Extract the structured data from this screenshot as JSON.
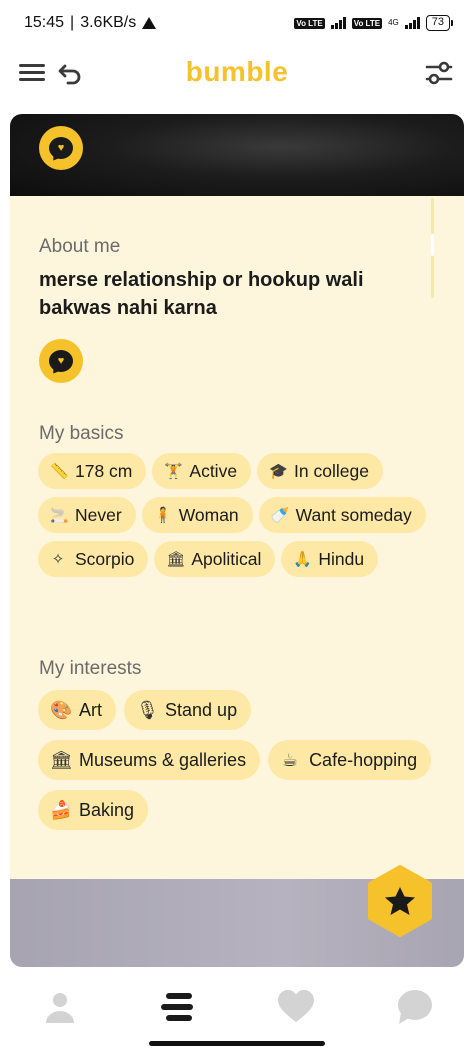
{
  "status_bar": {
    "time": "15:45",
    "speed": "3.6KB/s",
    "battery": "73",
    "net_tag_1": "Vo LTE",
    "net_tag_2": "Vo LTE",
    "net_label": "4G"
  },
  "header": {
    "logo": "bumble"
  },
  "profile": {
    "about": {
      "title": "About me",
      "text": "merse relationship or hookup wali bakwas nahi karna"
    },
    "basics": {
      "title": "My basics",
      "items": [
        {
          "icon": "ruler-icon",
          "glyph": "📏",
          "label": "178 cm"
        },
        {
          "icon": "dumbbell-icon",
          "glyph": "🏋",
          "label": "Active"
        },
        {
          "icon": "graduation-cap-icon",
          "glyph": "🎓",
          "label": "In college"
        },
        {
          "icon": "smoking-icon",
          "glyph": "🚬",
          "label": "Never"
        },
        {
          "icon": "person-icon",
          "glyph": "🧍",
          "label": "Woman"
        },
        {
          "icon": "bottle-icon",
          "glyph": "🍼",
          "label": "Want someday"
        },
        {
          "icon": "zodiac-icon",
          "glyph": "✧",
          "label": "Scorpio"
        },
        {
          "icon": "government-icon",
          "glyph": "🏛",
          "label": "Apolitical"
        },
        {
          "icon": "praying-hands-icon",
          "glyph": "🙏",
          "label": "Hindu"
        }
      ]
    },
    "interests": {
      "title": "My interests",
      "items": [
        {
          "icon": "palette-icon",
          "glyph": "🎨",
          "label": "Art"
        },
        {
          "icon": "microphone-icon",
          "glyph": "🎙",
          "label": "Stand up"
        },
        {
          "icon": "museum-icon",
          "glyph": "🏛",
          "label": "Museums & galleries"
        },
        {
          "icon": "coffee-icon",
          "glyph": "☕",
          "label": "Cafe-hopping"
        },
        {
          "icon": "cake-icon",
          "glyph": "🍰",
          "label": "Baking"
        }
      ]
    }
  },
  "colors": {
    "brand": "#f5c22c",
    "card_bg": "#fef6dc",
    "chip_bg": "#fde8a6"
  }
}
